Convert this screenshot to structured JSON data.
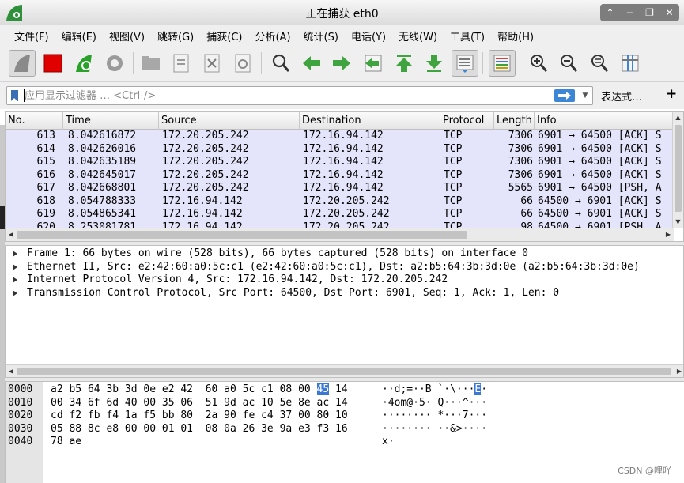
{
  "window": {
    "title": "正在捕获 eth0",
    "controls": [
      "↑",
      "−",
      "❐",
      "✕"
    ]
  },
  "menubar": {
    "items": [
      "文件(F)",
      "编辑(E)",
      "视图(V)",
      "跳转(G)",
      "捕获(C)",
      "分析(A)",
      "统计(S)",
      "电话(Y)",
      "无线(W)",
      "工具(T)",
      "帮助(H)"
    ]
  },
  "toolbar": {
    "buttons": [
      "start-capture-icon",
      "stop-capture-icon",
      "restart-capture-icon",
      "capture-options-icon",
      "open-file-icon",
      "save-file-icon",
      "close-file-icon",
      "reload-file-icon",
      "find-packet-icon",
      "go-back-icon",
      "go-forward-icon",
      "go-to-packet-icon",
      "go-first-icon",
      "go-last-icon",
      "auto-scroll-icon",
      "colorize-icon",
      "zoom-in-icon",
      "zoom-out-icon",
      "zoom-reset-icon",
      "resize-columns-icon"
    ],
    "colors": {
      "stop": "#e00000",
      "restart": "#2aa12a",
      "arrow": "#3fa33f",
      "accent": "#3c86d6"
    }
  },
  "filter": {
    "placeholder": "应用显示过滤器 … <Ctrl-/>",
    "value": "",
    "expression_label": "表达式…",
    "add_label": "+"
  },
  "packet_list": {
    "columns": [
      "No.",
      "Time",
      "Source",
      "Destination",
      "Protocol",
      "Length",
      "Info"
    ],
    "row_color": "#e4e4fb",
    "rows": [
      {
        "no": "613",
        "time": "8.042616872",
        "src": "172.20.205.242",
        "dst": "172.16.94.142",
        "proto": "TCP",
        "len": "7306",
        "info": "6901 → 64500 [ACK] S"
      },
      {
        "no": "614",
        "time": "8.042626016",
        "src": "172.20.205.242",
        "dst": "172.16.94.142",
        "proto": "TCP",
        "len": "7306",
        "info": "6901 → 64500 [ACK] S"
      },
      {
        "no": "615",
        "time": "8.042635189",
        "src": "172.20.205.242",
        "dst": "172.16.94.142",
        "proto": "TCP",
        "len": "7306",
        "info": "6901 → 64500 [ACK] S"
      },
      {
        "no": "616",
        "time": "8.042645017",
        "src": "172.20.205.242",
        "dst": "172.16.94.142",
        "proto": "TCP",
        "len": "7306",
        "info": "6901 → 64500 [ACK] S"
      },
      {
        "no": "617",
        "time": "8.042668801",
        "src": "172.20.205.242",
        "dst": "172.16.94.142",
        "proto": "TCP",
        "len": "5565",
        "info": "6901 → 64500 [PSH, A"
      },
      {
        "no": "618",
        "time": "8.054788333",
        "src": "172.16.94.142",
        "dst": "172.20.205.242",
        "proto": "TCP",
        "len": "66",
        "info": "64500 → 6901 [ACK] S"
      },
      {
        "no": "619",
        "time": "8.054865341",
        "src": "172.16.94.142",
        "dst": "172.20.205.242",
        "proto": "TCP",
        "len": "66",
        "info": "64500 → 6901 [ACK] S"
      },
      {
        "no": "620",
        "time": "8.253081781",
        "src": "172.16.94.142",
        "dst": "172.20.205.242",
        "proto": "TCP",
        "len": "98",
        "info": "64500 → 6901 [PSH, A"
      }
    ]
  },
  "details": {
    "lines": [
      "Frame 1: 66 bytes on wire (528 bits), 66 bytes captured (528 bits) on interface 0",
      "Ethernet II, Src: e2:42:60:a0:5c:c1 (e2:42:60:a0:5c:c1), Dst: a2:b5:64:3b:3d:0e (a2:b5:64:3b:3d:0e)",
      "Internet Protocol Version 4, Src: 172.16.94.142, Dst: 172.20.205.242",
      "Transmission Control Protocol, Src Port: 64500, Dst Port: 6901, Seq: 1, Ack: 1, Len: 0"
    ]
  },
  "bytes": {
    "rows": [
      {
        "offset": "0000",
        "hex_before": "a2 b5 64 3b 3d 0e e2 42  60 a0 5c c1 08 00 ",
        "hex_hl": "45",
        "hex_after": " 14",
        "ascii_before": "··d;=··B `·\\···",
        "ascii_hl": "E",
        "ascii_after": "·"
      },
      {
        "offset": "0010",
        "hex_before": "00 34 6f 6d 40 00 35 06  51 9d ac 10 5e 8e ac 14",
        "hex_hl": "",
        "hex_after": "",
        "ascii_before": "·4om@·5· Q···^···",
        "ascii_hl": "",
        "ascii_after": ""
      },
      {
        "offset": "0020",
        "hex_before": "cd f2 fb f4 1a f5 bb 80  2a 90 fe c4 37 00 80 10",
        "hex_hl": "",
        "hex_after": "",
        "ascii_before": "········ *···7···",
        "ascii_hl": "",
        "ascii_after": ""
      },
      {
        "offset": "0030",
        "hex_before": "05 88 8c e8 00 00 01 01  08 0a 26 3e 9a e3 f3 16",
        "hex_hl": "",
        "hex_after": "",
        "ascii_before": "········ ··&>····",
        "ascii_hl": "",
        "ascii_after": ""
      },
      {
        "offset": "0040",
        "hex_before": "78 ae",
        "hex_hl": "",
        "hex_after": "",
        "ascii_before": "x·",
        "ascii_hl": "",
        "ascii_after": ""
      }
    ]
  },
  "watermark": "CSDN @哩吖"
}
